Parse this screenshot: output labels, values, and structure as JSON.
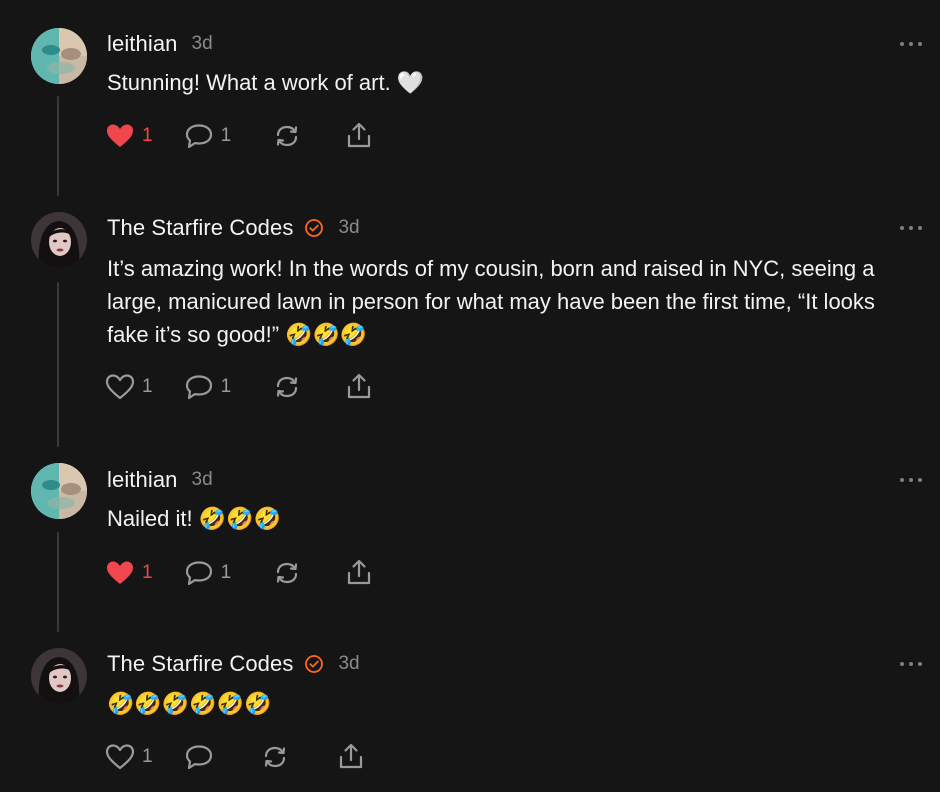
{
  "posts": [
    {
      "author": "leithian",
      "time": "3d",
      "verified": false,
      "text": "Stunning! What a work of art. 🤍",
      "likes": "1",
      "liked": true,
      "replies": "1"
    },
    {
      "author": "The Starfire Codes",
      "time": "3d",
      "verified": true,
      "text": "It’s amazing work! In the words of my cousin, born and raised in NYC, seeing a large, manicured lawn in person for what may have been the first time, “It looks fake it’s so good!” 🤣🤣🤣",
      "likes": "1",
      "liked": false,
      "replies": "1"
    },
    {
      "author": "leithian",
      "time": "3d",
      "verified": false,
      "text": "Nailed it! 🤣🤣🤣",
      "likes": "1",
      "liked": true,
      "replies": "1"
    },
    {
      "author": "The Starfire Codes",
      "time": "3d",
      "verified": true,
      "text": "🤣🤣🤣🤣🤣🤣",
      "likes": "1",
      "liked": false,
      "replies": ""
    }
  ],
  "colors": {
    "background": "#151515",
    "like_active": "#f0474e",
    "verified_badge": "#ff6719",
    "muted": "#8a8a8a"
  },
  "icons": {
    "like": "heart-icon",
    "reply": "speech-bubble-icon",
    "restack": "restack-arrows-icon",
    "share": "share-upload-icon",
    "more": "ellipsis-icon",
    "verified": "verified-check-badge-icon"
  }
}
